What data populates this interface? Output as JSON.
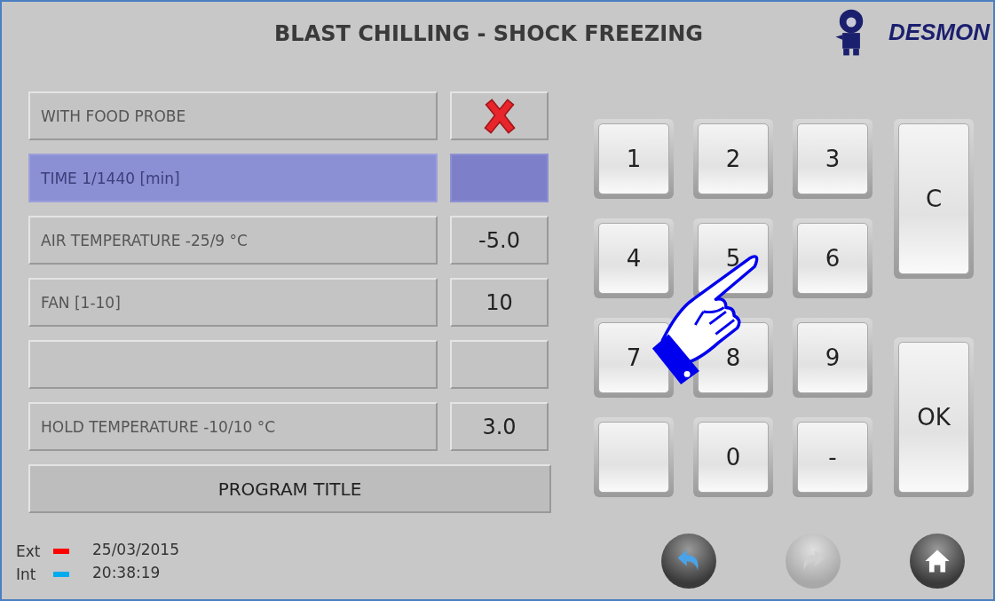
{
  "header": {
    "title": "BLAST CHILLING - SHOCK FREEZING",
    "logo_text": "DESMON"
  },
  "parameters": [
    {
      "label": "WITH FOOD PROBE",
      "kind": "toggle",
      "on": false,
      "selected": false
    },
    {
      "label": "TIME 1/1440 [min]",
      "kind": "value",
      "selected": true
    },
    {
      "label": "AIR TEMPERATURE -25/9 °C",
      "kind": "value",
      "value": "-5.0",
      "selected": false
    },
    {
      "label": "FAN [1-10]",
      "kind": "value",
      "value": "10",
      "selected": false
    },
    {
      "kind": "value",
      "selected": false
    },
    {
      "label": "HOLD TEMPERATURE -10/10 °C",
      "kind": "value",
      "value": "3.0",
      "selected": false
    }
  ],
  "program_title_button": "PROGRAM TITLE",
  "keypad": {
    "digits": [
      {
        "kind": "key",
        "label": "1"
      },
      {
        "kind": "key",
        "label": "2"
      },
      {
        "kind": "key",
        "label": "3"
      },
      {
        "kind": "key",
        "label": "4"
      },
      {
        "kind": "key",
        "label": "5"
      },
      {
        "kind": "key",
        "label": "6"
      },
      {
        "kind": "key",
        "label": "7"
      },
      {
        "kind": "key",
        "label": "8"
      },
      {
        "kind": "key",
        "label": "9"
      },
      {
        "kind": "blank"
      },
      {
        "kind": "key",
        "label": "0"
      },
      {
        "kind": "key",
        "label": "-"
      }
    ],
    "side_keys": [
      {
        "label": "C"
      },
      {
        "label": "OK"
      }
    ]
  },
  "legend": [
    {
      "label": "Ext",
      "color": "#ff0000"
    },
    {
      "label": "Int",
      "color": "#00aaee"
    }
  ],
  "date": "25/03/2015",
  "time": "20:38:19",
  "nav": [
    {
      "kind": "back",
      "disabled": false
    },
    {
      "kind": "forward",
      "disabled": true
    },
    {
      "kind": "home",
      "disabled": false
    }
  ]
}
